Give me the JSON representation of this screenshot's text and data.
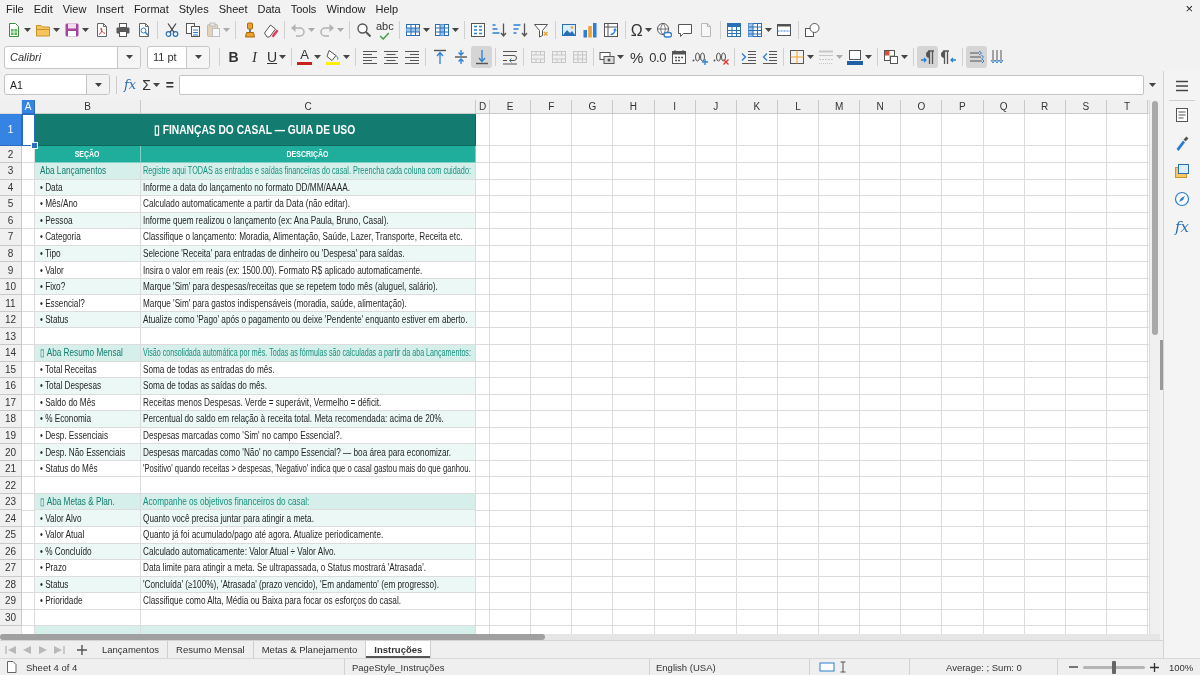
{
  "menu_bar": {
    "items": [
      "File",
      "Edit",
      "View",
      "Insert",
      "Format",
      "Styles",
      "Sheet",
      "Data",
      "Tools",
      "Window",
      "Help"
    ],
    "close": "×"
  },
  "standard_toolbar": {
    "buttons": [
      {
        "kind": "new",
        "disabled": false
      },
      {
        "kind": "open",
        "disabled": false
      },
      {
        "kind": "save",
        "disabled": false
      },
      {
        "kind": "export-pdf",
        "disabled": false
      },
      {
        "kind": "print",
        "disabled": false
      },
      {
        "kind": "print-preview",
        "disabled": false
      },
      {
        "kind": "cut",
        "disabled": false
      },
      {
        "kind": "copy",
        "disabled": false
      },
      {
        "kind": "paste",
        "disabled": true
      },
      {
        "kind": "clone-formatting",
        "disabled": false
      },
      {
        "kind": "clear-formatting",
        "disabled": false
      },
      {
        "kind": "undo",
        "disabled": true
      },
      {
        "kind": "redo",
        "disabled": true
      },
      {
        "kind": "find-replace",
        "disabled": false
      },
      {
        "kind": "spelling",
        "label": "abc",
        "disabled": false
      },
      {
        "kind": "row",
        "disabled": false
      },
      {
        "kind": "column",
        "disabled": false
      },
      {
        "kind": "sort",
        "disabled": false
      },
      {
        "kind": "sort-ascending",
        "disabled": false
      },
      {
        "kind": "sort-descending",
        "disabled": false
      },
      {
        "kind": "autofilter",
        "disabled": false
      },
      {
        "kind": "image",
        "disabled": false
      },
      {
        "kind": "chart",
        "disabled": false
      },
      {
        "kind": "pivot-table",
        "disabled": false
      },
      {
        "kind": "special-character",
        "label": "Ω",
        "disabled": false
      },
      {
        "kind": "hyperlink",
        "disabled": false
      },
      {
        "kind": "comment",
        "disabled": false
      },
      {
        "kind": "header-footer",
        "disabled": true
      },
      {
        "kind": "print-area",
        "disabled": false
      },
      {
        "kind": "freeze",
        "disabled": false
      },
      {
        "kind": "split",
        "disabled": false
      },
      {
        "kind": "shapes",
        "disabled": false
      }
    ]
  },
  "formatting_toolbar": {
    "font_name": "Calibri",
    "font_size": "11 pt",
    "buttons": [
      {
        "kind": "bold",
        "label": "B",
        "on": false,
        "disabled": false
      },
      {
        "kind": "italic",
        "label": "I",
        "on": false,
        "disabled": false
      },
      {
        "kind": "underline",
        "label": "U",
        "on": false,
        "disabled": false
      },
      {
        "kind": "font-color",
        "label": "A",
        "on": false,
        "disabled": false
      },
      {
        "kind": "highlight",
        "on": false,
        "disabled": false
      },
      {
        "kind": "align-left",
        "on": false,
        "disabled": false
      },
      {
        "kind": "align-center",
        "on": false,
        "disabled": false
      },
      {
        "kind": "align-right",
        "on": false,
        "disabled": false
      },
      {
        "kind": "align-top",
        "on": false,
        "disabled": false
      },
      {
        "kind": "align-middle",
        "on": false,
        "disabled": false
      },
      {
        "kind": "align-bottom",
        "on": true,
        "disabled": false
      },
      {
        "kind": "wrap",
        "on": false,
        "disabled": false
      },
      {
        "kind": "merge-center",
        "on": false,
        "disabled": true
      },
      {
        "kind": "merge",
        "on": false,
        "disabled": true
      },
      {
        "kind": "unmerge",
        "on": false,
        "disabled": true
      },
      {
        "kind": "currency",
        "on": false,
        "disabled": false
      },
      {
        "kind": "percent",
        "label": "%",
        "on": false,
        "disabled": false
      },
      {
        "kind": "number",
        "label": "0.0",
        "on": false,
        "disabled": false
      },
      {
        "kind": "date",
        "on": false,
        "disabled": false
      },
      {
        "kind": "add-decimal",
        "on": false,
        "disabled": false
      },
      {
        "kind": "delete-decimal",
        "on": false,
        "disabled": false
      },
      {
        "kind": "indent-increase",
        "on": false,
        "disabled": false
      },
      {
        "kind": "indent-decrease",
        "on": false,
        "disabled": false
      },
      {
        "kind": "borders",
        "on": false,
        "disabled": false
      },
      {
        "kind": "border-style",
        "on": false,
        "disabled": true
      },
      {
        "kind": "border-color",
        "on": false,
        "disabled": false
      },
      {
        "kind": "conditional",
        "on": false,
        "disabled": false
      },
      {
        "kind": "paragraph-ltr",
        "on": true,
        "disabled": false
      },
      {
        "kind": "paragraph-rtl",
        "on": false,
        "disabled": false
      },
      {
        "kind": "text-ltr",
        "on": true,
        "disabled": false
      },
      {
        "kind": "text-vertical",
        "on": false,
        "disabled": false
      }
    ]
  },
  "formula_bar": {
    "name_box": "A1",
    "function_wizard": "fx",
    "sum": "Σ",
    "equals": "="
  },
  "sheet": {
    "columns": [
      {
        "label": "A",
        "selected": true
      },
      {
        "label": "B",
        "selected": false
      },
      {
        "label": "C",
        "selected": false
      },
      {
        "label": "D",
        "selected": false
      },
      {
        "label": "E",
        "selected": false
      },
      {
        "label": "F",
        "selected": false
      },
      {
        "label": "G",
        "selected": false
      },
      {
        "label": "H",
        "selected": false
      },
      {
        "label": "I",
        "selected": false
      },
      {
        "label": "J",
        "selected": false
      },
      {
        "label": "K",
        "selected": false
      },
      {
        "label": "L",
        "selected": false
      },
      {
        "label": "M",
        "selected": false
      },
      {
        "label": "N",
        "selected": false
      },
      {
        "label": "O",
        "selected": false
      },
      {
        "label": "P",
        "selected": false
      },
      {
        "label": "Q",
        "selected": false
      },
      {
        "label": "R",
        "selected": false
      },
      {
        "label": "S",
        "selected": false
      },
      {
        "label": "T",
        "selected": false
      }
    ],
    "rows": [
      {
        "number": "1",
        "selected": true,
        "kind": "title",
        "text": "▯ FINANÇAS DO CASAL — GUIA DE USO"
      },
      {
        "number": "2",
        "selected": false,
        "kind": "header",
        "section": "SEÇÃO",
        "description": "DESCRIÇÃO"
      },
      {
        "number": "3",
        "selected": false,
        "kind": "section",
        "section": "Aba Lançamentos",
        "description": "Registre aqui TODAS as entradas e saídas financeiras do casal. Preencha cada coluna com cuidado:"
      },
      {
        "number": "4",
        "selected": false,
        "kind": "item",
        "banded": true,
        "section": "• Data",
        "description": "Informe a data do lançamento no formato DD/MM/AAAA."
      },
      {
        "number": "5",
        "selected": false,
        "kind": "item",
        "banded": false,
        "section": "• Mês/Ano",
        "description": "Calculado automaticamente a partir da Data (não editar)."
      },
      {
        "number": "6",
        "selected": false,
        "kind": "item",
        "banded": true,
        "section": "• Pessoa",
        "description": "Informe quem realizou o lançamento (ex: Ana Paula, Bruno, Casal)."
      },
      {
        "number": "7",
        "selected": false,
        "kind": "item",
        "banded": false,
        "section": "• Categoria",
        "description": "Classifique o lançamento: Moradia, Alimentação, Saúde, Lazer, Transporte, Receita etc."
      },
      {
        "number": "8",
        "selected": false,
        "kind": "item",
        "banded": true,
        "section": "• Tipo",
        "description": "Selecione 'Receita' para entradas de dinheiro ou 'Despesa' para saídas."
      },
      {
        "number": "9",
        "selected": false,
        "kind": "item",
        "banded": false,
        "section": "• Valor",
        "description": "Insira o valor em reais (ex: 1500.00). Formato R$ aplicado automaticamente."
      },
      {
        "number": "10",
        "selected": false,
        "kind": "item",
        "banded": true,
        "section": "• Fixo?",
        "description": "Marque 'Sim' para despesas/receitas que se repetem todo mês (aluguel, salário)."
      },
      {
        "number": "11",
        "selected": false,
        "kind": "item",
        "banded": false,
        "section": "• Essencial?",
        "description": "Marque 'Sim' para gastos indispensáveis (moradia, saúde, alimentação)."
      },
      {
        "number": "12",
        "selected": false,
        "kind": "item",
        "banded": true,
        "section": "• Status",
        "description": "Atualize como 'Pago' após o pagamento ou deixe 'Pendente' enquanto estiver em aberto."
      },
      {
        "number": "13",
        "selected": false,
        "kind": "blank"
      },
      {
        "number": "14",
        "selected": false,
        "kind": "section",
        "section": "▯ Aba Resumo Mensal",
        "description": "Visão consolidada automática por mês. Todas as fórmulas são calculadas a partir da aba Lançamentos:"
      },
      {
        "number": "15",
        "selected": false,
        "kind": "item",
        "banded": false,
        "section": "• Total Receitas",
        "description": "Soma de todas as entradas do mês."
      },
      {
        "number": "16",
        "selected": false,
        "kind": "item",
        "banded": true,
        "section": "• Total Despesas",
        "description": "Soma de todas as saídas do mês."
      },
      {
        "number": "17",
        "selected": false,
        "kind": "item",
        "banded": false,
        "section": "• Saldo do Mês",
        "description": "Receitas menos Despesas. Verde = superávit, Vermelho = déficit."
      },
      {
        "number": "18",
        "selected": false,
        "kind": "item",
        "banded": true,
        "section": "• % Economia",
        "description": "Percentual do saldo em relação à receita total. Meta recomendada: acima de 20%."
      },
      {
        "number": "19",
        "selected": false,
        "kind": "item",
        "banded": false,
        "section": "• Desp. Essenciais",
        "description": "Despesas marcadas como 'Sim' no campo Essencial?."
      },
      {
        "number": "20",
        "selected": false,
        "kind": "item",
        "banded": true,
        "section": "• Desp. Não Essenciais",
        "description": "Despesas marcadas como 'Não' no campo Essencial? — boa área para economizar."
      },
      {
        "number": "21",
        "selected": false,
        "kind": "item",
        "banded": false,
        "section": "• Status do Mês",
        "description": "'Positivo' quando receitas > despesas, 'Negativo' indica que o casal gastou mais do que ganhou."
      },
      {
        "number": "22",
        "selected": false,
        "kind": "blank"
      },
      {
        "number": "23",
        "selected": false,
        "kind": "section",
        "section": "▯ Aba Metas & Plan.",
        "description": "Acompanhe os objetivos financeiros do casal:"
      },
      {
        "number": "24",
        "selected": false,
        "kind": "item",
        "banded": true,
        "section": "• Valor Alvo",
        "description": "Quanto você precisa juntar para atingir a meta."
      },
      {
        "number": "25",
        "selected": false,
        "kind": "item",
        "banded": false,
        "section": "• Valor Atual",
        "description": "Quanto já foi acumulado/pago até agora. Atualize periodicamente."
      },
      {
        "number": "26",
        "selected": false,
        "kind": "item",
        "banded": true,
        "section": "• % Concluído",
        "description": "Calculado automaticamente: Valor Atual ÷ Valor Alvo."
      },
      {
        "number": "27",
        "selected": false,
        "kind": "item",
        "banded": false,
        "section": "• Prazo",
        "description": "Data limite para atingir a meta. Se ultrapassada, o Status mostrará 'Atrasada'."
      },
      {
        "number": "28",
        "selected": false,
        "kind": "item",
        "banded": true,
        "section": "• Status",
        "description": "'Concluída' (≥100%), 'Atrasada' (prazo vencido), 'Em andamento' (em progresso)."
      },
      {
        "number": "29",
        "selected": false,
        "kind": "item",
        "banded": false,
        "section": "• Prioridade",
        "description": "Classifique como Alta, Média ou Baixa para focar os esforços do casal."
      },
      {
        "number": "30",
        "selected": false,
        "kind": "blank"
      },
      {
        "kind": "section"
      }
    ]
  },
  "sheet_tabs": {
    "navigation": [
      {
        "kind": "first",
        "disabled": true
      },
      {
        "kind": "previous",
        "disabled": true
      },
      {
        "kind": "next",
        "disabled": true
      },
      {
        "kind": "last",
        "disabled": true
      }
    ],
    "tabs": [
      {
        "label": "Lançamentos",
        "selected": false
      },
      {
        "label": "Resumo Mensal",
        "selected": false
      },
      {
        "label": "Metas & Planejamento",
        "selected": false
      },
      {
        "label": "Instruções",
        "selected": true
      }
    ]
  },
  "sidebar": {
    "functions_button": "fx"
  },
  "status_bar": {
    "sheet_position": "Sheet 4 of 4",
    "page_style": "PageStyle_Instruções",
    "language": "English (USA)",
    "selection_summary": "Average: ; Sum: 0",
    "zoom": {
      "level": 0.5,
      "reading": "100%"
    }
  }
}
